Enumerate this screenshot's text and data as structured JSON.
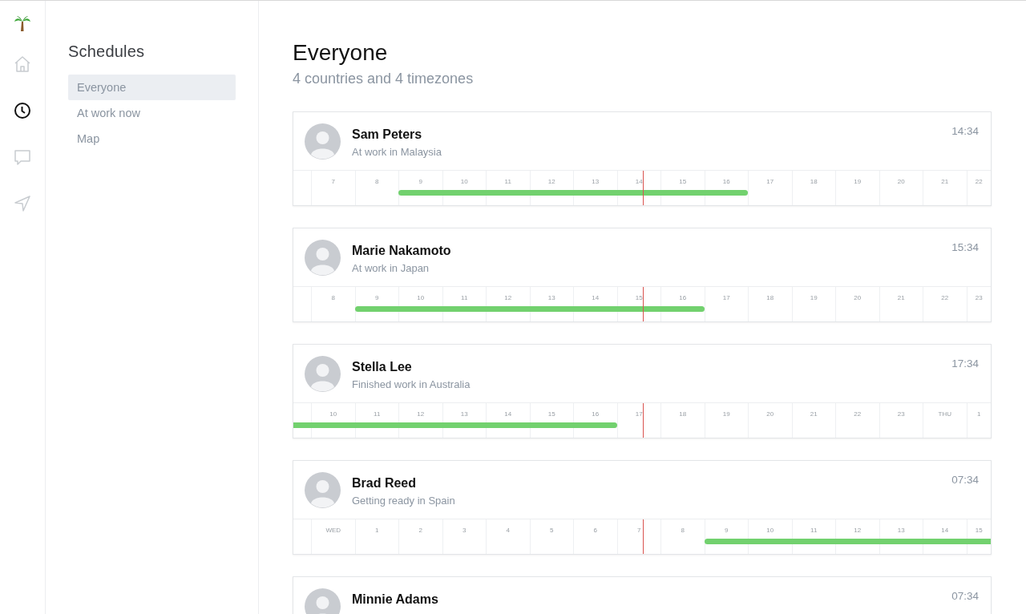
{
  "rail": [
    {
      "kind": "home",
      "selected": false
    },
    {
      "kind": "clock",
      "selected": true
    },
    {
      "kind": "chat",
      "selected": false
    },
    {
      "kind": "send",
      "selected": false
    }
  ],
  "sidebar": {
    "title": "Schedules",
    "items": [
      {
        "label": "Everyone",
        "selected": true
      },
      {
        "label": "At work now",
        "selected": false
      },
      {
        "label": "Map",
        "selected": false
      }
    ]
  },
  "header": {
    "title": "Everyone",
    "subtitle": "4 countries and 4 timezones"
  },
  "people": [
    {
      "name": "Sam Peters",
      "status": "At work in Malaysia",
      "time": "14:34",
      "lead_working": false,
      "timeline": [
        {
          "label": "7",
          "working": false,
          "current": false
        },
        {
          "label": "8",
          "working": false,
          "current": false
        },
        {
          "label": "9",
          "working": true,
          "current": false
        },
        {
          "label": "10",
          "working": true,
          "current": false
        },
        {
          "label": "11",
          "working": true,
          "current": false
        },
        {
          "label": "12",
          "working": true,
          "current": false
        },
        {
          "label": "13",
          "working": true,
          "current": false
        },
        {
          "label": "14",
          "working": true,
          "current": true
        },
        {
          "label": "15",
          "working": true,
          "current": false
        },
        {
          "label": "16",
          "working": true,
          "current": false
        },
        {
          "label": "17",
          "working": false,
          "current": false
        },
        {
          "label": "18",
          "working": false,
          "current": false
        },
        {
          "label": "19",
          "working": false,
          "current": false
        },
        {
          "label": "20",
          "working": false,
          "current": false
        },
        {
          "label": "21",
          "working": false,
          "current": false
        },
        {
          "label": "22",
          "working": false,
          "current": false
        }
      ]
    },
    {
      "name": "Marie Nakamoto",
      "status": "At work in Japan",
      "time": "15:34",
      "lead_working": false,
      "timeline": [
        {
          "label": "8",
          "working": false,
          "current": false
        },
        {
          "label": "9",
          "working": true,
          "current": false
        },
        {
          "label": "10",
          "working": true,
          "current": false
        },
        {
          "label": "11",
          "working": true,
          "current": false
        },
        {
          "label": "12",
          "working": true,
          "current": false
        },
        {
          "label": "13",
          "working": true,
          "current": false
        },
        {
          "label": "14",
          "working": true,
          "current": false
        },
        {
          "label": "15",
          "working": true,
          "current": true
        },
        {
          "label": "16",
          "working": true,
          "current": false
        },
        {
          "label": "17",
          "working": false,
          "current": false
        },
        {
          "label": "18",
          "working": false,
          "current": false
        },
        {
          "label": "19",
          "working": false,
          "current": false
        },
        {
          "label": "20",
          "working": false,
          "current": false
        },
        {
          "label": "21",
          "working": false,
          "current": false
        },
        {
          "label": "22",
          "working": false,
          "current": false
        },
        {
          "label": "23",
          "working": false,
          "current": false
        }
      ]
    },
    {
      "name": "Stella Lee",
      "status": "Finished work in Australia",
      "time": "17:34",
      "lead_working": true,
      "timeline": [
        {
          "label": "10",
          "working": true,
          "current": false
        },
        {
          "label": "11",
          "working": true,
          "current": false
        },
        {
          "label": "12",
          "working": true,
          "current": false
        },
        {
          "label": "13",
          "working": true,
          "current": false
        },
        {
          "label": "14",
          "working": true,
          "current": false
        },
        {
          "label": "15",
          "working": true,
          "current": false
        },
        {
          "label": "16",
          "working": true,
          "current": false
        },
        {
          "label": "17",
          "working": false,
          "current": true
        },
        {
          "label": "18",
          "working": false,
          "current": false
        },
        {
          "label": "19",
          "working": false,
          "current": false
        },
        {
          "label": "20",
          "working": false,
          "current": false
        },
        {
          "label": "21",
          "working": false,
          "current": false
        },
        {
          "label": "22",
          "working": false,
          "current": false
        },
        {
          "label": "23",
          "working": false,
          "current": false
        },
        {
          "label": "THU",
          "working": false,
          "current": false
        },
        {
          "label": "1",
          "working": false,
          "current": false
        }
      ]
    },
    {
      "name": "Brad Reed",
      "status": "Getting ready in Spain",
      "time": "07:34",
      "lead_working": false,
      "timeline": [
        {
          "label": "WED",
          "working": false,
          "current": false
        },
        {
          "label": "1",
          "working": false,
          "current": false
        },
        {
          "label": "2",
          "working": false,
          "current": false
        },
        {
          "label": "3",
          "working": false,
          "current": false
        },
        {
          "label": "4",
          "working": false,
          "current": false
        },
        {
          "label": "5",
          "working": false,
          "current": false
        },
        {
          "label": "6",
          "working": false,
          "current": false
        },
        {
          "label": "7",
          "working": false,
          "current": true
        },
        {
          "label": "8",
          "working": false,
          "current": false
        },
        {
          "label": "9",
          "working": true,
          "current": false
        },
        {
          "label": "10",
          "working": true,
          "current": false
        },
        {
          "label": "11",
          "working": true,
          "current": false
        },
        {
          "label": "12",
          "working": true,
          "current": false
        },
        {
          "label": "13",
          "working": true,
          "current": false
        },
        {
          "label": "14",
          "working": true,
          "current": false
        },
        {
          "label": "15",
          "working": true,
          "current": false
        }
      ]
    },
    {
      "name": "Minnie Adams",
      "time": "07:34"
    }
  ]
}
